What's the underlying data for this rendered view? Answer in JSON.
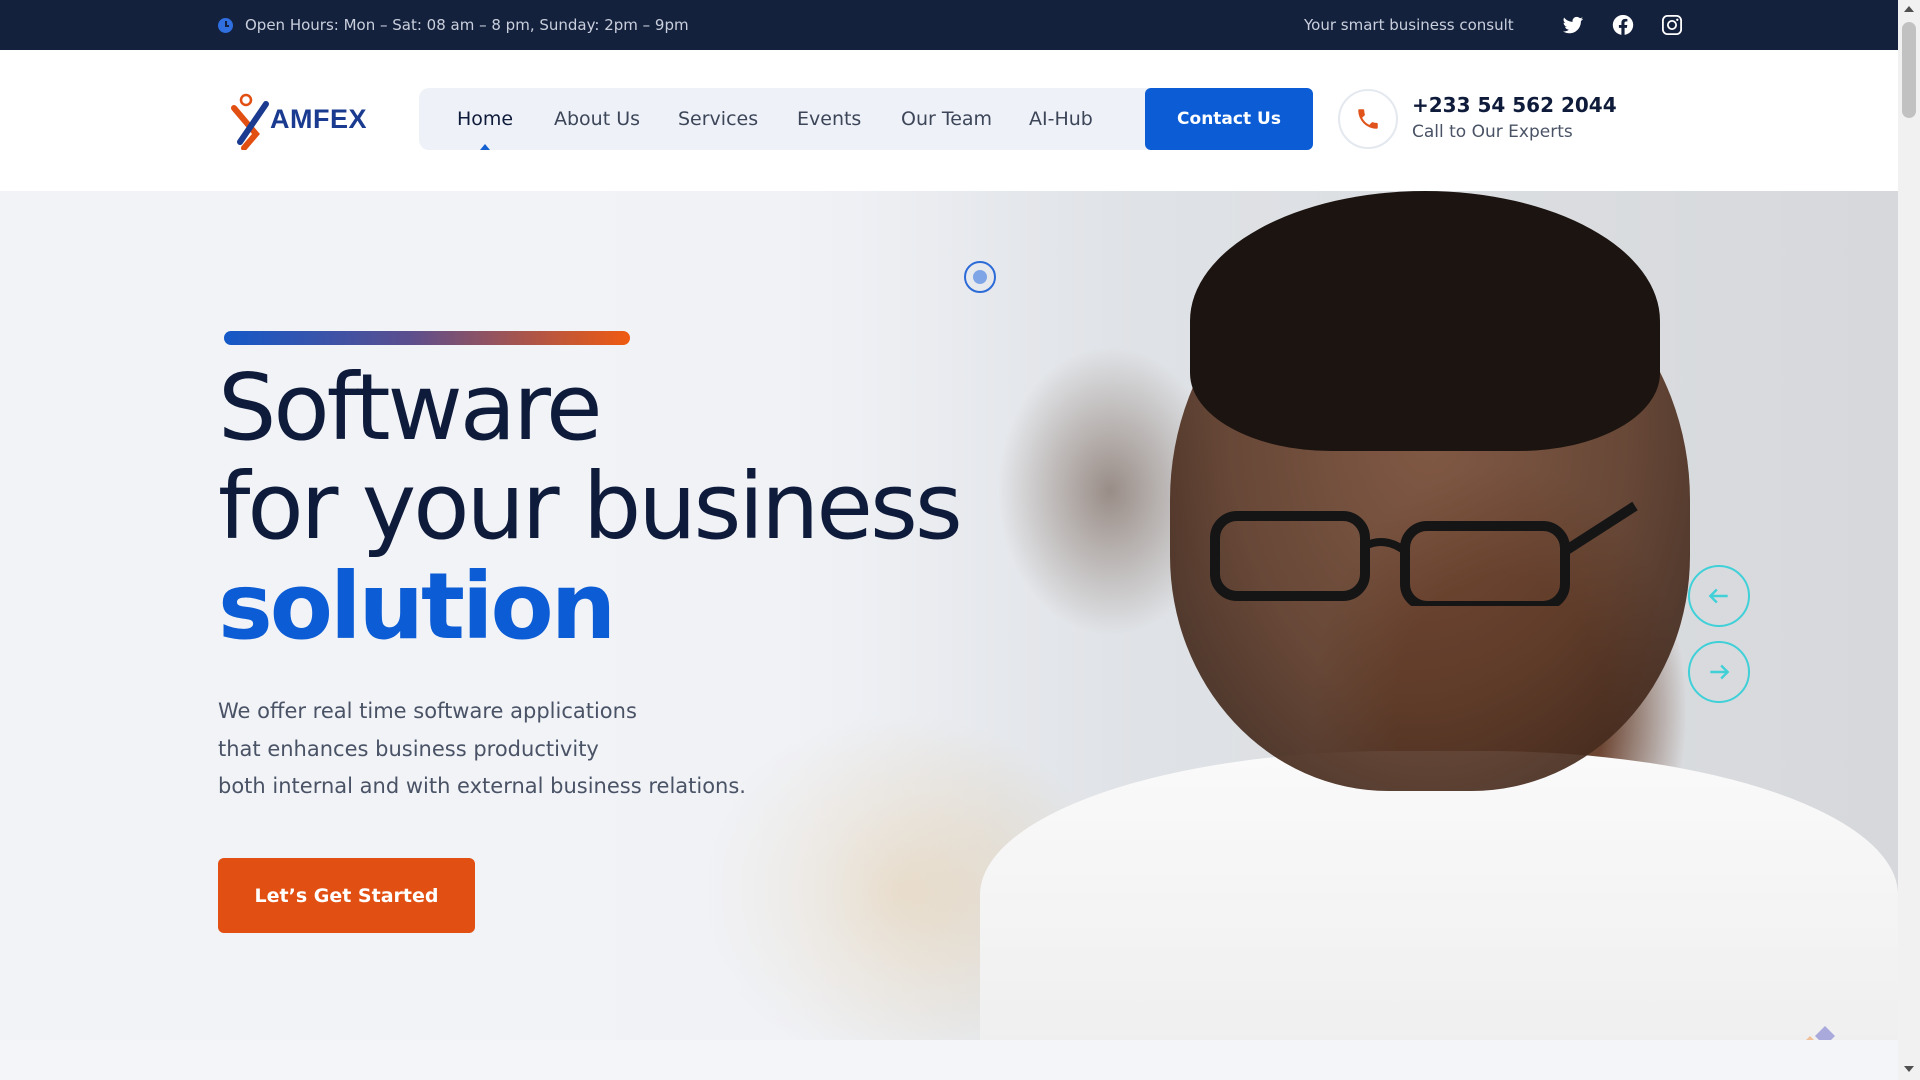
{
  "topbar": {
    "hours": "Open Hours: Mon – Sat: 08 am – 8 pm, Sunday: 2pm – 9pm",
    "tagline": "Your smart business consult",
    "social": [
      "twitter-icon",
      "facebook-icon",
      "instagram-icon"
    ]
  },
  "header": {
    "logo_text": "AMFEX",
    "nav": [
      "Home",
      "About Us",
      "Services",
      "Events",
      "Our Team",
      "AI-Hub"
    ],
    "active_nav": "Home",
    "contact_label": "Contact Us",
    "phone": "+233 54 562 2044",
    "phone_sub": "Call to Our Experts"
  },
  "hero": {
    "line1": "Software",
    "line2": "for your business",
    "line3": "solution",
    "desc1": "We offer real time software applications",
    "desc2": "that enhances business productivity",
    "desc3": "both internal and with external business relations.",
    "cta": "Let’s Get Started"
  },
  "colors": {
    "topbar": "#14213d",
    "brand_blue": "#0b5cd5",
    "brand_orange": "#e24f12",
    "arrow_cyan": "#3fd0d8"
  }
}
